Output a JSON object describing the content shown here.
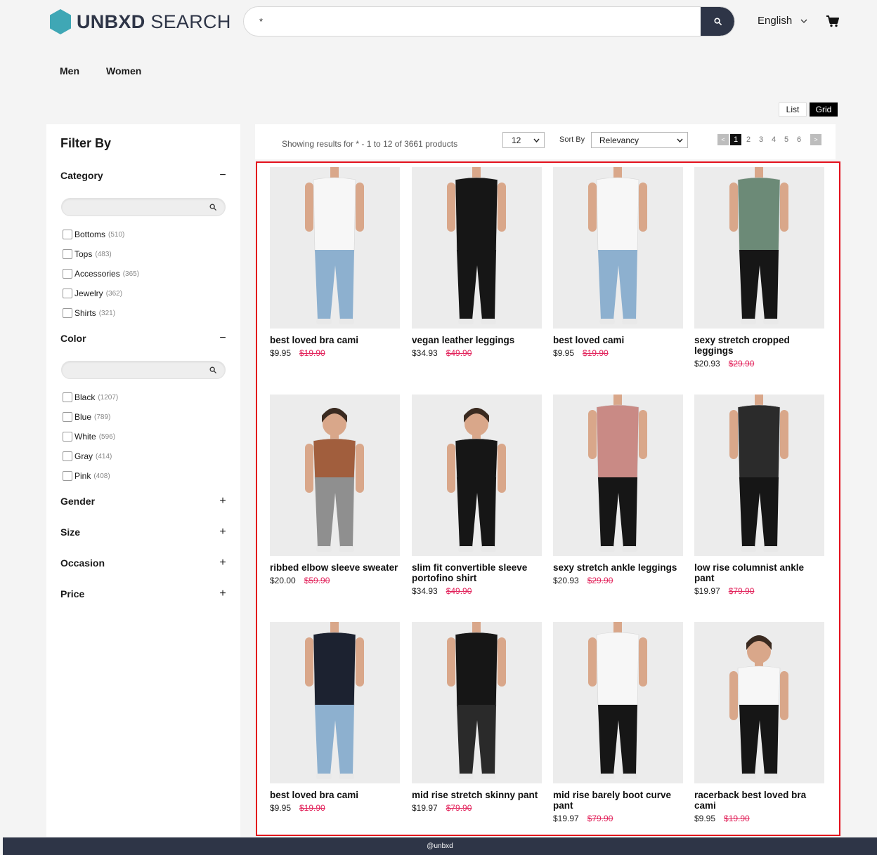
{
  "brand": {
    "bold": "UNBXD",
    "light": " SEARCH",
    "logo_color": "#3fa7b5"
  },
  "search": {
    "value": "*",
    "placeholder": ""
  },
  "language": {
    "label": "English"
  },
  "nav": {
    "men": "Men",
    "women": "Women"
  },
  "view": {
    "list": "List",
    "grid": "Grid",
    "active": "Grid"
  },
  "sidebar": {
    "title": "Filter By",
    "category": {
      "label": "Category",
      "toggle": "−",
      "items": [
        {
          "label": "Bottoms",
          "count": "(510)"
        },
        {
          "label": "Tops",
          "count": "(483)"
        },
        {
          "label": "Accessories",
          "count": "(365)"
        },
        {
          "label": "Jewelry",
          "count": "(362)"
        },
        {
          "label": "Shirts",
          "count": "(321)"
        }
      ]
    },
    "color": {
      "label": "Color",
      "toggle": "−",
      "items": [
        {
          "label": "Black",
          "count": "(1207)"
        },
        {
          "label": "Blue",
          "count": "(789)"
        },
        {
          "label": "White",
          "count": "(596)"
        },
        {
          "label": "Gray",
          "count": "(414)"
        },
        {
          "label": "Pink",
          "count": "(408)"
        }
      ]
    },
    "gender": {
      "label": "Gender",
      "toggle": "+"
    },
    "size": {
      "label": "Size",
      "toggle": "+"
    },
    "occasion": {
      "label": "Occasion",
      "toggle": "+"
    },
    "price": {
      "label": "Price",
      "toggle": "+"
    }
  },
  "results": {
    "text": "Showing results for * - 1 to 12 of 3661 products",
    "per_page": "12",
    "sort_label": "Sort By",
    "sort_value": "Relevancy",
    "pages": [
      "1",
      "2",
      "3",
      "4",
      "5",
      "6"
    ],
    "current_page": "1",
    "prev": "<",
    "next": ">"
  },
  "products": [
    {
      "title": "best loved bra cami",
      "price": "$9.95",
      "was": "$19.90",
      "top": "white",
      "bottom": "jeans"
    },
    {
      "title": "vegan leather leggings",
      "price": "$34.93",
      "was": "$49.90",
      "top": "none",
      "bottom": "black"
    },
    {
      "title": "best loved cami",
      "price": "$9.95",
      "was": "$19.90",
      "top": "white",
      "bottom": "jeans"
    },
    {
      "title": "sexy stretch cropped leggings",
      "price": "$20.93",
      "was": "$29.90",
      "top": "green",
      "bottom": "black"
    },
    {
      "title": "ribbed elbow sleeve sweater",
      "price": "$20.00",
      "was": "$59.90",
      "top": "rust",
      "bottom": "plaid"
    },
    {
      "title": "slim fit convertible sleeve portofino shirt",
      "price": "$34.93",
      "was": "$49.90",
      "top": "black",
      "bottom": "black"
    },
    {
      "title": "sexy stretch ankle leggings",
      "price": "$20.93",
      "was": "$29.90",
      "top": "pink",
      "bottom": "black"
    },
    {
      "title": "low rise columnist ankle pant",
      "price": "$19.97",
      "was": "$79.90",
      "top": "stripe",
      "bottom": "black"
    },
    {
      "title": "best loved bra cami",
      "price": "$9.95",
      "was": "$19.90",
      "top": "navy",
      "bottom": "jeans"
    },
    {
      "title": "mid rise stretch skinny pant",
      "price": "$19.97",
      "was": "$79.90",
      "top": "black",
      "bottom": "charcoal"
    },
    {
      "title": "mid rise barely boot curve pant",
      "price": "$19.97",
      "was": "$79.90",
      "top": "white",
      "bottom": "black"
    },
    {
      "title": "racerback best loved bra cami",
      "price": "$9.95",
      "was": "$19.90",
      "top": "white",
      "bottom": "black"
    }
  ],
  "footer": {
    "text": "@unbxd"
  }
}
